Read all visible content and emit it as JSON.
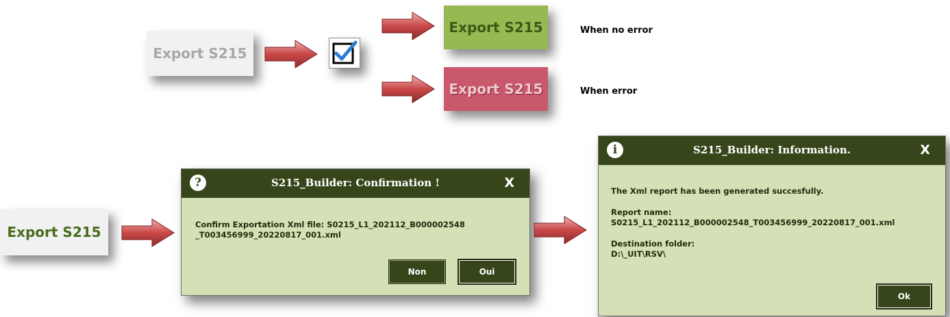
{
  "top": {
    "export_disabled_label": "Export S215",
    "export_success_label": "Export S215",
    "export_error_label": "Export S215",
    "note_no_error": "When no error",
    "note_error": "When error"
  },
  "bottom": {
    "export_label": "Export S215"
  },
  "confirm_dialog": {
    "icon": "question-icon",
    "title": "S215_Builder: Confirmation !",
    "close_label": "X",
    "message_line1": "Confirm Exportation Xml file: S0215_L1_202112_B000002548",
    "message_line2": "_T003456999_20220817_001.xml",
    "no_label": "Non",
    "yes_label": "Oui"
  },
  "info_dialog": {
    "icon": "info-icon",
    "title": "S215_Builder: Information.",
    "close_label": "X",
    "message": "The Xml report has been  generated succesfully.",
    "report_name_label": "Report name:",
    "report_name_value": "S0215_L1_202112_B000002548_T003456999_20220817_001.xml",
    "destination_label": "Destination folder:",
    "destination_value": "D:\\_UIT\\RSV\\",
    "ok_label": "Ok"
  },
  "colors": {
    "success": "#97b952",
    "error": "#c9586c",
    "dialog_bg": "#d5e0b6",
    "title_bar": "#36461a",
    "arrow": "#c9494a",
    "checkbox_check": "#2a7fd6"
  }
}
